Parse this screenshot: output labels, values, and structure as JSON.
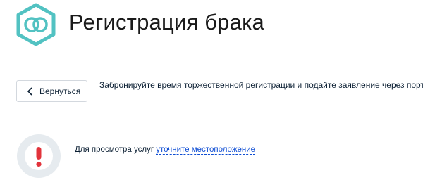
{
  "header": {
    "title": "Регистрация брака",
    "icon": "wedding-rings-icon",
    "accent_color": "#52c2c2"
  },
  "back_button": {
    "label": "Вернуться",
    "icon": "chevron-left-icon"
  },
  "intro": {
    "text": "Забронируйте время торжественной регистрации и подайте заявление через портал"
  },
  "location_notice": {
    "icon": "exclamation-icon",
    "icon_color": "#e2333b",
    "icon_bg": "#e6ebef",
    "prefix": "Для просмотра услуг",
    "link_label": "уточните местоположение",
    "link_color": "#0d4cd3"
  }
}
